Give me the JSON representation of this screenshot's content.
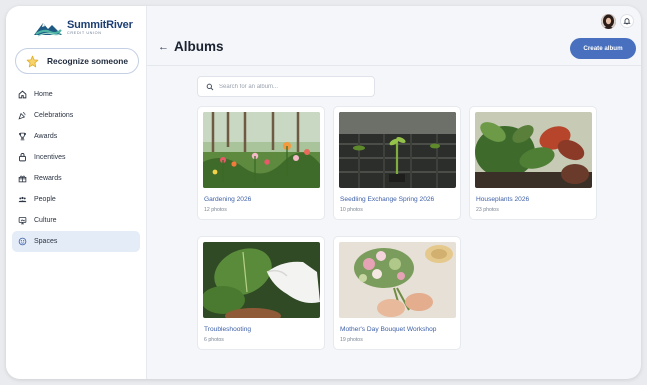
{
  "brand": {
    "name": "SummitRiver",
    "tagline": "CREDIT UNION"
  },
  "recognize_button": "Recognize someone",
  "nav": [
    {
      "label": "Home",
      "icon": "home-icon",
      "active": false
    },
    {
      "label": "Celebrations",
      "icon": "party-icon",
      "active": false
    },
    {
      "label": "Awards",
      "icon": "trophy-icon",
      "active": false
    },
    {
      "label": "Incentives",
      "icon": "incentive-icon",
      "active": false
    },
    {
      "label": "Rewards",
      "icon": "gift-icon",
      "active": false
    },
    {
      "label": "People",
      "icon": "people-icon",
      "active": false
    },
    {
      "label": "Culture",
      "icon": "culture-icon",
      "active": false
    },
    {
      "label": "Spaces",
      "icon": "spaces-icon",
      "active": true
    }
  ],
  "header": {
    "title": "Albums",
    "create_label": "Create album"
  },
  "search": {
    "placeholder": "Search for an album..."
  },
  "albums": [
    {
      "title": "Gardening 2026",
      "count": "12 photos"
    },
    {
      "title": "Seedling Exchange Spring 2026",
      "count": "10 photos"
    },
    {
      "title": "Houseplants 2026",
      "count": "23 photos"
    },
    {
      "title": "Troubleshooting",
      "count": "6 photos"
    },
    {
      "title": "Mother's Day Bouquet Workshop",
      "count": "19 photos"
    }
  ],
  "colors": {
    "accent": "#4870be",
    "active_nav": "#e4ecf8",
    "link": "#3d5fa8"
  }
}
